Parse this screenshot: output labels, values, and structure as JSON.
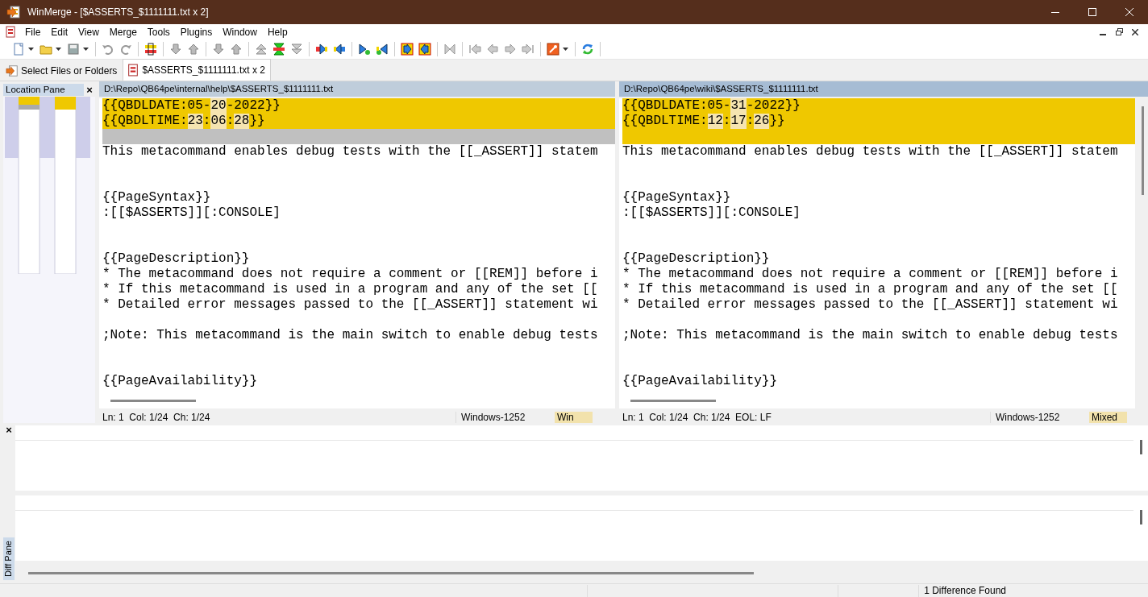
{
  "window": {
    "title": "WinMerge - [$ASSERTS_$1111111.txt x 2]"
  },
  "menu": [
    "File",
    "Edit",
    "View",
    "Merge",
    "Tools",
    "Plugins",
    "Window",
    "Help"
  ],
  "tabs": [
    {
      "label": "Select Files or Folders",
      "selected": false
    },
    {
      "label": "$ASSERTS_$1111111.txt x 2",
      "selected": true
    }
  ],
  "location_pane": {
    "title": "Location Pane",
    "close": "×"
  },
  "files": [
    {
      "path": "D:\\Repo\\QB64pe\\internal\\help\\$ASSERTS_$1111111.txt",
      "active": false,
      "lines": [
        {
          "kind": "changed",
          "segments": [
            {
              "text": "{{QBDLDATE:05-",
              "changed": false
            },
            {
              "text": "20",
              "changed": true
            },
            {
              "text": "-2022}}",
              "changed": false
            }
          ]
        },
        {
          "kind": "changed",
          "segments": [
            {
              "text": "{{QBDLTIME:",
              "changed": false
            },
            {
              "text": "23",
              "changed": true
            },
            {
              "text": ":",
              "changed": false
            },
            {
              "text": "06",
              "changed": true
            },
            {
              "text": ":",
              "changed": false
            },
            {
              "text": "28",
              "changed": true
            },
            {
              "text": "}}",
              "changed": false
            }
          ]
        },
        {
          "kind": "missing"
        },
        {
          "kind": "same",
          "text": "This metacommand enables debug tests with the [[_ASSERT]] statem"
        },
        {
          "kind": "same"
        },
        {
          "kind": "same"
        },
        {
          "kind": "same",
          "text": "{{PageSyntax}}"
        },
        {
          "kind": "same",
          "text": ":[[$ASSERTS]][:CONSOLE]"
        },
        {
          "kind": "same"
        },
        {
          "kind": "same"
        },
        {
          "kind": "same",
          "text": "{{PageDescription}}"
        },
        {
          "kind": "same",
          "text": "* The metacommand does not require a comment or [[REM]] before i"
        },
        {
          "kind": "same",
          "text": "* If this metacommand is used in a program and any of the set [["
        },
        {
          "kind": "same",
          "text": "* Detailed error messages passed to the [[_ASSERT]] statement wi"
        },
        {
          "kind": "same"
        },
        {
          "kind": "same",
          "text": ";Note: This metacommand is the main switch to enable debug tests"
        },
        {
          "kind": "same"
        },
        {
          "kind": "same"
        },
        {
          "kind": "same",
          "text": "{{PageAvailability}}"
        }
      ],
      "status": {
        "position": "Ln: 1  Col: 1/24  Ch: 1/24",
        "encoding": "Windows-1252",
        "eol": "Win"
      }
    },
    {
      "path": "D:\\Repo\\QB64pe\\wiki\\$ASSERTS_$1111111.txt",
      "active": true,
      "lines": [
        {
          "kind": "changed",
          "segments": [
            {
              "text": "{{QBDLDATE:05-",
              "changed": false
            },
            {
              "text": "31",
              "changed": true
            },
            {
              "text": "-2022}}",
              "changed": false
            }
          ]
        },
        {
          "kind": "changed",
          "segments": [
            {
              "text": "{{QBDLTIME:",
              "changed": false
            },
            {
              "text": "12",
              "changed": true
            },
            {
              "text": ":",
              "changed": false
            },
            {
              "text": "17",
              "changed": true
            },
            {
              "text": ":",
              "changed": false
            },
            {
              "text": "26",
              "changed": true
            },
            {
              "text": "}}",
              "changed": false
            }
          ]
        },
        {
          "kind": "changed"
        },
        {
          "kind": "same",
          "text": "This metacommand enables debug tests with the [[_ASSERT]] statem"
        },
        {
          "kind": "same"
        },
        {
          "kind": "same"
        },
        {
          "kind": "same",
          "text": "{{PageSyntax}}"
        },
        {
          "kind": "same",
          "text": ":[[$ASSERTS]][:CONSOLE]"
        },
        {
          "kind": "same"
        },
        {
          "kind": "same"
        },
        {
          "kind": "same",
          "text": "{{PageDescription}}"
        },
        {
          "kind": "same",
          "text": "* The metacommand does not require a comment or [[REM]] before i"
        },
        {
          "kind": "same",
          "text": "* If this metacommand is used in a program and any of the set [["
        },
        {
          "kind": "same",
          "text": "* Detailed error messages passed to the [[_ASSERT]] statement wi"
        },
        {
          "kind": "same"
        },
        {
          "kind": "same",
          "text": ";Note: This metacommand is the main switch to enable debug tests"
        },
        {
          "kind": "same"
        },
        {
          "kind": "same"
        },
        {
          "kind": "same",
          "text": "{{PageAvailability}}"
        }
      ],
      "status": {
        "position": "Ln: 1  Col: 1/24  Ch: 1/24  EOL: LF",
        "encoding": "Windows-1252",
        "eol": "Mixed"
      }
    }
  ],
  "diff_pane": {
    "title": "Diff Pane",
    "close": "×"
  },
  "status_bar": {
    "message": "1 Difference Found"
  }
}
